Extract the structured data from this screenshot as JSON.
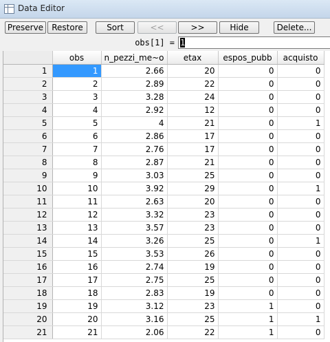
{
  "window": {
    "title": "Data Editor",
    "icon": "table-window-icon"
  },
  "toolbar": {
    "preserve": "Preserve",
    "restore": "Restore",
    "sort": "Sort",
    "prev": "<<",
    "next": ">>",
    "hide": "Hide",
    "delete": "Delete..."
  },
  "formula": {
    "label": "obs[1] =",
    "value": "1"
  },
  "grid": {
    "columns": [
      "obs",
      "n_pezzi_me~o",
      "etax",
      "espos_pubb",
      "acquisto"
    ],
    "rows": [
      [
        "1",
        "1",
        "2.66",
        "20",
        "0",
        "0"
      ],
      [
        "2",
        "2",
        "2.89",
        "22",
        "0",
        "0"
      ],
      [
        "3",
        "3",
        "3.28",
        "24",
        "0",
        "0"
      ],
      [
        "4",
        "4",
        "2.92",
        "12",
        "0",
        "0"
      ],
      [
        "5",
        "5",
        "4",
        "21",
        "0",
        "1"
      ],
      [
        "6",
        "6",
        "2.86",
        "17",
        "0",
        "0"
      ],
      [
        "7",
        "7",
        "2.76",
        "17",
        "0",
        "0"
      ],
      [
        "8",
        "8",
        "2.87",
        "21",
        "0",
        "0"
      ],
      [
        "9",
        "9",
        "3.03",
        "25",
        "0",
        "0"
      ],
      [
        "10",
        "10",
        "3.92",
        "29",
        "0",
        "1"
      ],
      [
        "11",
        "11",
        "2.63",
        "20",
        "0",
        "0"
      ],
      [
        "12",
        "12",
        "3.32",
        "23",
        "0",
        "0"
      ],
      [
        "13",
        "13",
        "3.57",
        "23",
        "0",
        "0"
      ],
      [
        "14",
        "14",
        "3.26",
        "25",
        "0",
        "1"
      ],
      [
        "15",
        "15",
        "3.53",
        "26",
        "0",
        "0"
      ],
      [
        "16",
        "16",
        "2.74",
        "19",
        "0",
        "0"
      ],
      [
        "17",
        "17",
        "2.75",
        "25",
        "0",
        "0"
      ],
      [
        "18",
        "18",
        "2.83",
        "19",
        "0",
        "0"
      ],
      [
        "19",
        "19",
        "3.12",
        "23",
        "1",
        "0"
      ],
      [
        "20",
        "20",
        "3.16",
        "25",
        "1",
        "1"
      ],
      [
        "21",
        "21",
        "2.06",
        "22",
        "1",
        "0"
      ]
    ],
    "selected_cell": {
      "row": 0,
      "col": 0
    },
    "selection_color": "#3399ff"
  }
}
